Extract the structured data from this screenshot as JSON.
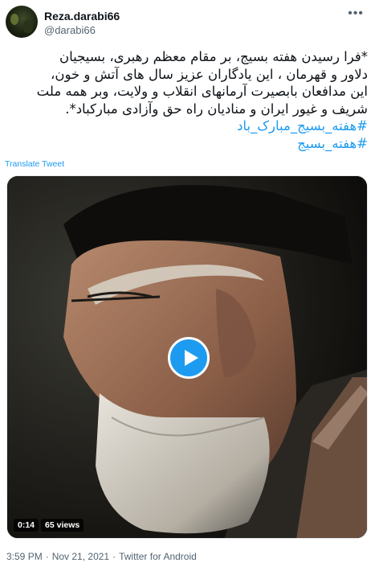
{
  "user": {
    "name": "Reza.darabi66",
    "handle": "@darabi66"
  },
  "tweet": {
    "lines": [
      "*فرا رسیدن هفته بسیج، بر مقام معظم رهبری، بسیجیان",
      "دلاور و قهرمان ، این یادگاران عزیز سال های آتش و خون،",
      "این مدافعان بابصیرت آرمانهای انقلاب و ولایت، وبر همه ملت",
      "شریف و غیور ایران و منادیان راه حق وآزادی مبارکباد*."
    ],
    "hashtags": [
      "#هفته_بسیج_مبارک_باد",
      "#هفته_بسیج"
    ],
    "translate_label": "Translate Tweet"
  },
  "media": {
    "duration": "0:14",
    "views": "65 views",
    "play_icon": "play-icon"
  },
  "footer": {
    "time": "3:59 PM",
    "date": "Nov 21, 2021",
    "source": "Twitter for Android",
    "separator": "·"
  }
}
